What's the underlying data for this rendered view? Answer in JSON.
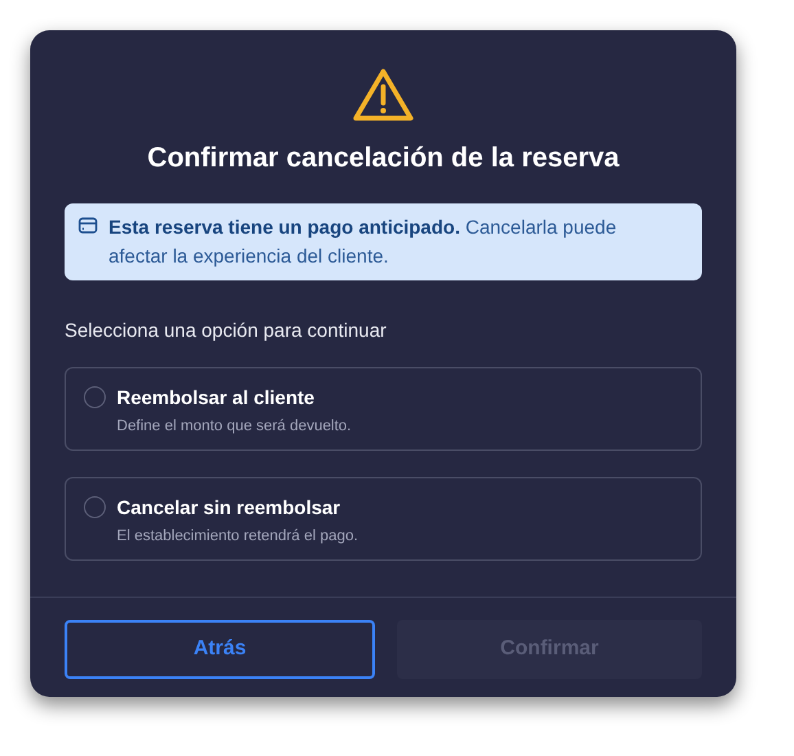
{
  "dialog": {
    "title": "Confirmar cancelación de la reserva",
    "alert": {
      "text": "**Esta reserva tiene un pago anticipado.** Cancelarla puede afectar la experiencia del cliente."
    },
    "prompt": "Selecciona una opción para continuar",
    "options": [
      {
        "label": "Reembolsar al cliente",
        "description": "Define el monto que será devuelto.",
        "selected": false
      },
      {
        "label": "Cancelar sin reembolsar",
        "description": "El establecimiento retendrá el pago.",
        "selected": false
      }
    ],
    "buttons": [
      {
        "label": "Atrás",
        "disabled": false
      },
      {
        "label": "Confirmar",
        "disabled": true
      }
    ]
  }
}
